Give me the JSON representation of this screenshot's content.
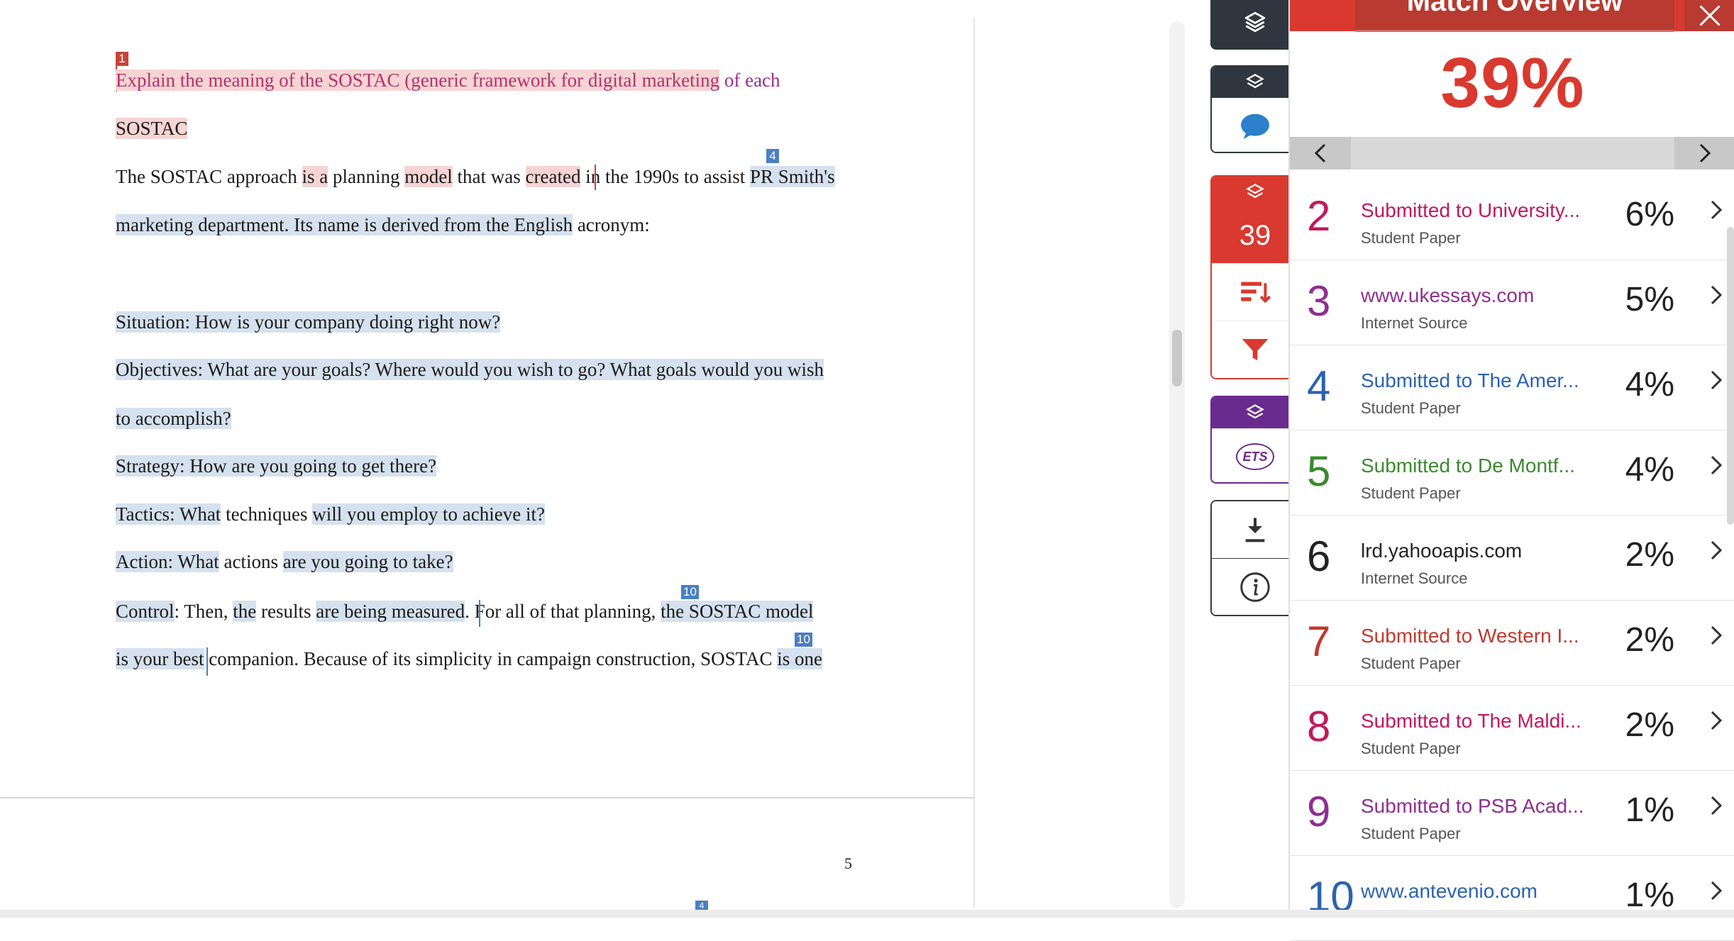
{
  "document": {
    "page_number": "5",
    "lines": {
      "l1": {
        "a": "Explain the meaning of the SOSTAC (generic framework for digital marketing",
        "b": " of each"
      },
      "l2": {
        "a": "SOSTAC"
      },
      "l3": {
        "a": "The SOSTAC approach ",
        "b": "is a",
        "c": " planning ",
        "d": "model",
        "e": " that was ",
        "f": "created",
        "g": " in the 1990s to assist ",
        "h": "PR Smith's"
      },
      "l4": {
        "a": "marketing department. Its name is derived from the English",
        "b": " acronym:"
      },
      "l5": {
        "a": "Situation: How is your company doing right now?"
      },
      "l6": {
        "a": "Objectives: What are your goals? Where would you wish to go? What goals would you wish"
      },
      "l7": {
        "a": "to accomplish?"
      },
      "l8": {
        "a": "Strategy: How are you going to get there?"
      },
      "l9": {
        "a": "Tactics: What",
        "b": " techniques ",
        "c": "will you employ to achieve it?"
      },
      "l10": {
        "a": "Action: What",
        "b": " actions ",
        "c": "are you going to take?"
      },
      "l11": {
        "a": "Control",
        "b": ":  Then, ",
        "c": "the",
        "d": " results ",
        "e": "are being measured",
        "f": ". For all of that planning, ",
        "g": "the SOSTAC model"
      },
      "l12": {
        "a": "is your best",
        "b": " companion. Because of its simplicity in campaign construction, SOSTAC ",
        "c": "is one"
      }
    },
    "markers": {
      "m1": "1",
      "m4": "4",
      "m10a": "10",
      "m10b": "10",
      "m4b": "4"
    }
  },
  "tools": {
    "similarity_score": "39",
    "icons": [
      "layers-icon",
      "comment-icon",
      "sort-icon",
      "filter-icon",
      "ets-icon",
      "download-icon",
      "info-icon"
    ],
    "ets_label": "ETS"
  },
  "panel": {
    "title": "Match Overview",
    "overall": "39%",
    "matches": [
      {
        "rank": "2",
        "source": "Submitted to University...",
        "type": "Student Paper",
        "percent": "6%",
        "color": "#c2185b"
      },
      {
        "rank": "3",
        "source": "www.ukessays.com",
        "type": "Internet Source",
        "percent": "5%",
        "color": "#8e2f8e"
      },
      {
        "rank": "4",
        "source": "Submitted to The Amer...",
        "type": "Student Paper",
        "percent": "4%",
        "color": "#2c62b0"
      },
      {
        "rank": "5",
        "source": "Submitted to De Montf...",
        "type": "Student Paper",
        "percent": "4%",
        "color": "#3a8a2e"
      },
      {
        "rank": "6",
        "source": "lrd.yahooapis.com",
        "type": "Internet Source",
        "percent": "2%",
        "color": "#222222"
      },
      {
        "rank": "7",
        "source": "Submitted to Western I...",
        "type": "Student Paper",
        "percent": "2%",
        "color": "#c0392b"
      },
      {
        "rank": "8",
        "source": "Submitted to The Maldi...",
        "type": "Student Paper",
        "percent": "2%",
        "color": "#c2185b"
      },
      {
        "rank": "9",
        "source": "Submitted to PSB Acad...",
        "type": "Student Paper",
        "percent": "1%",
        "color": "#8e2f8e"
      },
      {
        "rank": "10",
        "source": "www.antevenio.com",
        "type": "",
        "percent": "1%",
        "color": "#2c62b0"
      }
    ]
  }
}
